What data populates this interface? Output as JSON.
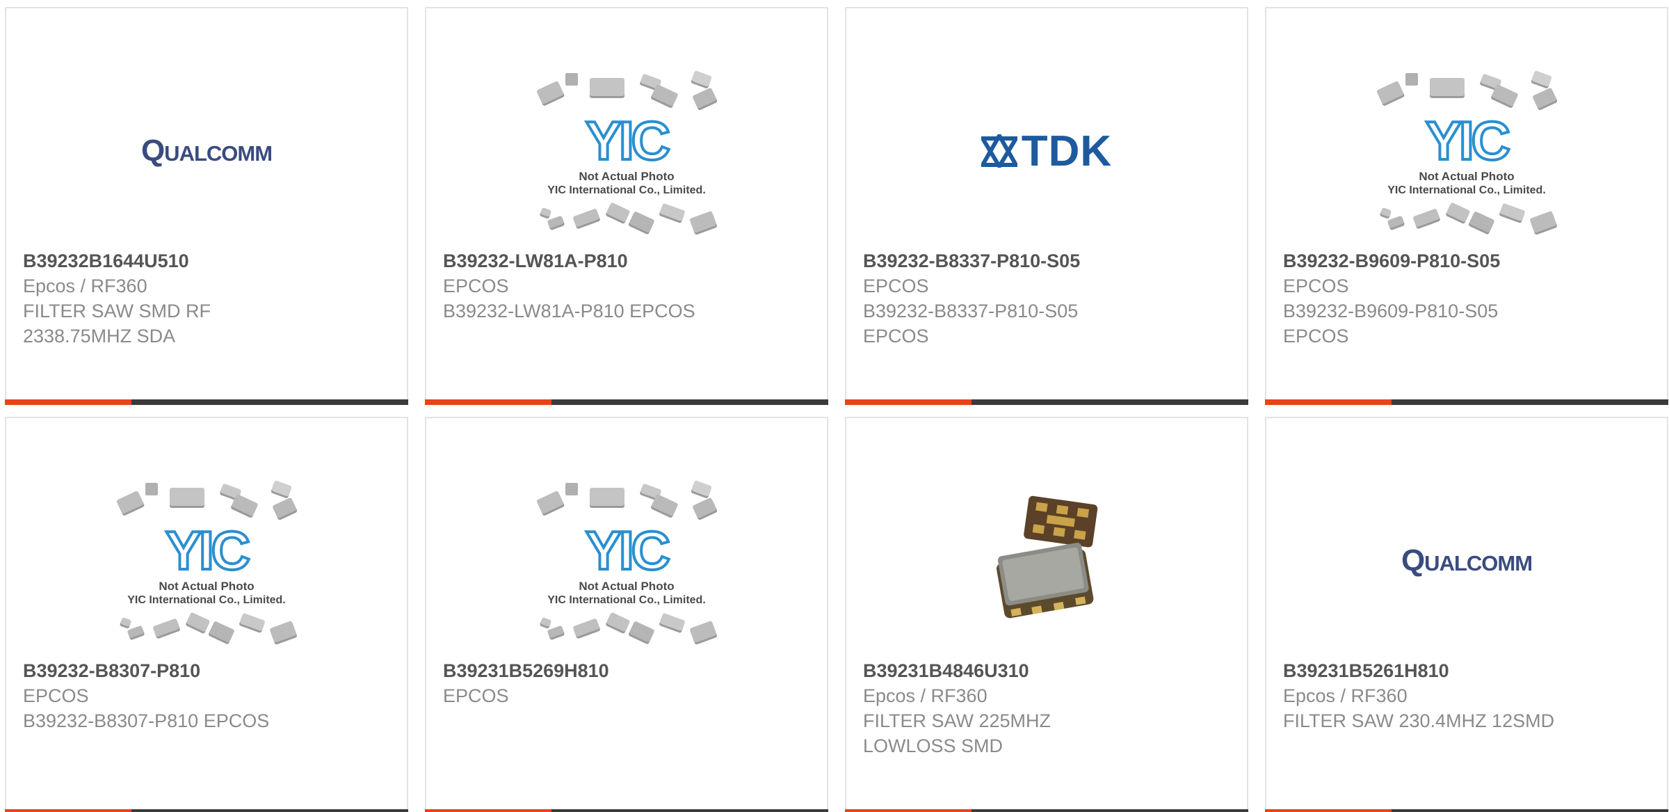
{
  "colors": {
    "accent": "#e8431b",
    "bar": "#3b3b3b",
    "part_number": "#555555",
    "secondary_text": "#8a8a8a",
    "qualcomm_logo": "#3a4b7e",
    "tdk_logo": "#1d5a9e",
    "yic_blue": "#2a8fd0"
  },
  "placeholder": {
    "line1": "Not Actual Photo",
    "line2": "YIC International Co., Limited.",
    "logo_text": "YIC"
  },
  "products": [
    {
      "part_number": "B39232B1644U510",
      "manufacturer": "Epcos / RF360",
      "description": "FILTER SAW SMD RF\n2338.75MHZ SDA",
      "image": "qualcomm-logo",
      "logo_text": "Qualcomm"
    },
    {
      "part_number": "B39232-LW81A-P810",
      "manufacturer": "EPCOS",
      "description": "B39232-LW81A-P810 EPCOS",
      "image": "yic-placeholder"
    },
    {
      "part_number": "B39232-B8337-P810-S05",
      "manufacturer": "EPCOS",
      "description": "B39232-B8337-P810-S05\nEPCOS",
      "image": "tdk-logo",
      "logo_text": "TDK"
    },
    {
      "part_number": "B39232-B9609-P810-S05",
      "manufacturer": "EPCOS",
      "description": "B39232-B9609-P810-S05\nEPCOS",
      "image": "yic-placeholder"
    },
    {
      "part_number": "B39232-B8307-P810",
      "manufacturer": "EPCOS",
      "description": "B39232-B8307-P810 EPCOS",
      "image": "yic-placeholder"
    },
    {
      "part_number": "B39231B5269H810",
      "manufacturer": "EPCOS",
      "description": "",
      "image": "yic-placeholder"
    },
    {
      "part_number": "B39231B4846U310",
      "manufacturer": "Epcos / RF360",
      "description": "FILTER SAW 225MHZ\nLOWLOSS SMD",
      "image": "smd-component-photo"
    },
    {
      "part_number": "B39231B5261H810",
      "manufacturer": "Epcos / RF360",
      "description": "FILTER SAW 230.4MHZ 12SMD",
      "image": "qualcomm-logo",
      "logo_text": "Qualcomm"
    }
  ]
}
